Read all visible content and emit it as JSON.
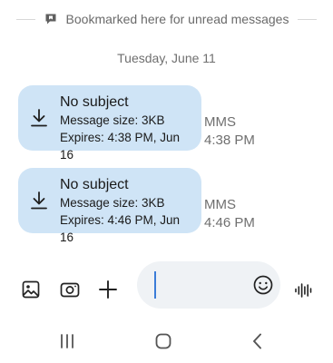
{
  "bookmark": {
    "label": "Bookmarked here for unread messages",
    "icon": "bookmark-chat-icon"
  },
  "date_header": "Tuesday, June 11",
  "messages": [
    {
      "subject": "No subject",
      "size": "Message size: 3KB",
      "expires": "Expires: 4:38 PM, Jun 16",
      "type": "MMS",
      "time": "4:38 PM",
      "icon": "download-icon"
    },
    {
      "subject": "No subject",
      "size": "Message size: 3KB",
      "expires": "Expires: 4:46 PM, Jun 16",
      "type": "MMS",
      "time": "4:46 PM",
      "icon": "download-icon"
    }
  ],
  "composer": {
    "placeholder": "",
    "value": "",
    "icons": [
      "gallery-icon",
      "camera-icon",
      "plus-icon",
      "emoji-icon",
      "voice-icon"
    ]
  },
  "navigation": {
    "icons": [
      "recents-icon",
      "home-icon",
      "back-icon"
    ]
  },
  "colors": {
    "bubble": "#cfe4f6",
    "input_field": "#eff2f5",
    "caret": "#3b7dd8",
    "secondary_text": "#6f6f6f"
  }
}
